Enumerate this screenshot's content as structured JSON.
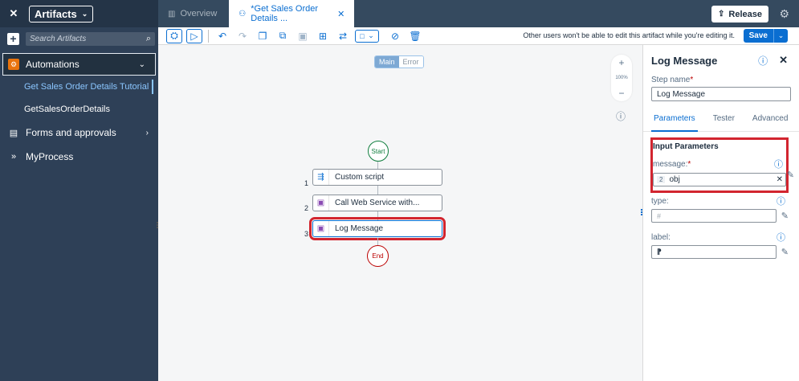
{
  "sidebar": {
    "title": "Artifacts",
    "search_placeholder": "Search Artifacts",
    "groups": [
      {
        "label": "Automations",
        "items": [
          "Get Sales Order Details Tutorial",
          "GetSalesOrderDetails"
        ]
      },
      {
        "label": "Forms and approvals"
      },
      {
        "label": "MyProcess"
      }
    ]
  },
  "tabs": {
    "overview": "Overview",
    "active": "*Get Sales Order Details ..."
  },
  "header": {
    "release_label": "Release"
  },
  "toolbar": {
    "note": "Other users won't be able to edit this artifact while you're editing it.",
    "save_label": "Save"
  },
  "canvas": {
    "toggle_main": "Main",
    "toggle_error": "Error",
    "zoom_level": "100%",
    "start_label": "Start",
    "end_label": "End",
    "steps": [
      {
        "num": "1",
        "label": "Custom script"
      },
      {
        "num": "2",
        "label": "Call Web Service with..."
      },
      {
        "num": "3",
        "label": "Log Message"
      }
    ]
  },
  "panel": {
    "title": "Log Message",
    "step_name_label": "Step name",
    "step_name_value": "Log Message",
    "tabs": [
      "Parameters",
      "Tester",
      "Advanced"
    ],
    "section_title": "Input Parameters",
    "fields": [
      {
        "label": "message:",
        "required": true,
        "badge": "2",
        "value": "obj"
      },
      {
        "label": "type:",
        "required": false,
        "value": ""
      },
      {
        "label": "label:",
        "required": false,
        "value": ""
      }
    ]
  },
  "colors": {
    "sidebar_bg": "#2e4057",
    "accent": "#0a6ed1",
    "highlight": "#d2252f",
    "start_green": "#107e3e",
    "end_red": "#bb0000",
    "automation_icon": "#e9730c"
  }
}
